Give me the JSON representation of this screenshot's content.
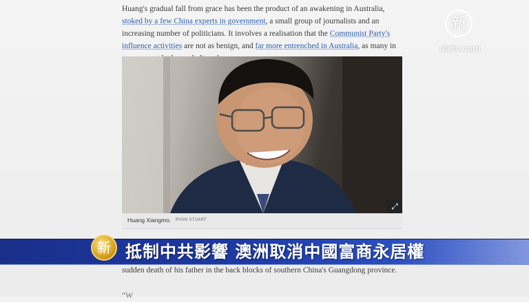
{
  "article": {
    "paragraph1": {
      "t1": "Huang's gradual fall from grace has been the product of an awakening in Australia, ",
      "link1": "stoked by a few China experts in government",
      "t2": ", a small group of journalists and an increasing number of politicians. It involves a realisation that the ",
      "link2": "Communist Party's influence activities",
      "t3": " are not as benign, and ",
      "link3": "far more entrenched in Australia",
      "t4": ", as many in government had once believed."
    },
    "paragraph2": "sudden death of his father in the back blocks of southern China's Guangdong province.",
    "paragraph3": "“W"
  },
  "photo": {
    "caption_name": "Huang Xiangmo.",
    "caption_credit": "RYAN STUART",
    "expand_icon": "expand-icon"
  },
  "logo": {
    "glyph": "新",
    "site": "ntdtv.com"
  },
  "banner": {
    "emblem_glyph": "新",
    "headline": "抵制中共影響 澳洲取消中國富商永居權",
    "color_dark": "#1a2f8a",
    "color_light": "#2b4fc2",
    "emblem_color": "#d8a11e"
  }
}
